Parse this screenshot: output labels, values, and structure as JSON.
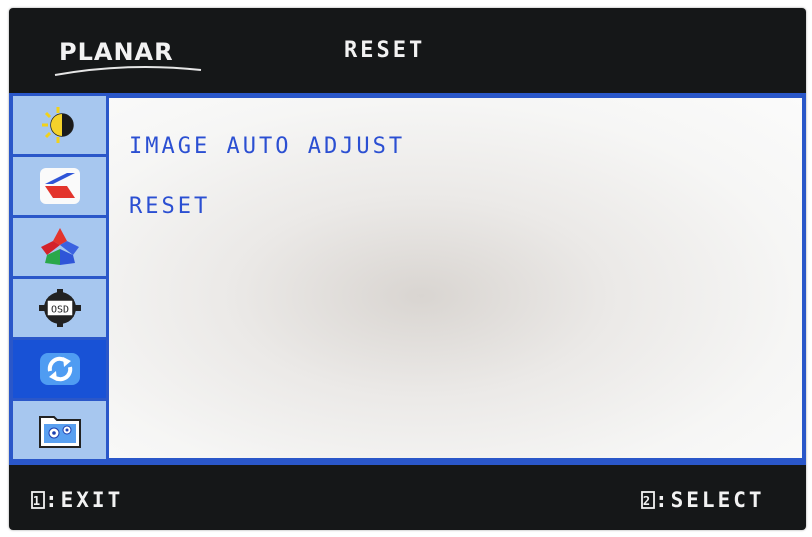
{
  "header": {
    "brand": "PLANAR",
    "title": "RESET"
  },
  "sidebar": {
    "items": [
      {
        "icon": "brightness-contrast-icon",
        "active": false
      },
      {
        "icon": "image-adjust-icon",
        "active": false
      },
      {
        "icon": "color-icon",
        "active": false
      },
      {
        "icon": "osd-settings-icon",
        "active": false
      },
      {
        "icon": "reset-icon",
        "active": true
      },
      {
        "icon": "advanced-settings-icon",
        "active": false
      }
    ]
  },
  "menu": {
    "items": [
      "IMAGE AUTO ADJUST",
      "RESET"
    ]
  },
  "footer": {
    "exit_key": "1",
    "exit_label": ":EXIT",
    "select_key": "2",
    "select_label": ":SELECT"
  },
  "colors": {
    "frame": "#151718",
    "accent_blue": "#2a57c9",
    "sidebar_item": "#a7c7ef",
    "sidebar_active": "#1852d6",
    "menu_text": "#2b4fd2"
  }
}
